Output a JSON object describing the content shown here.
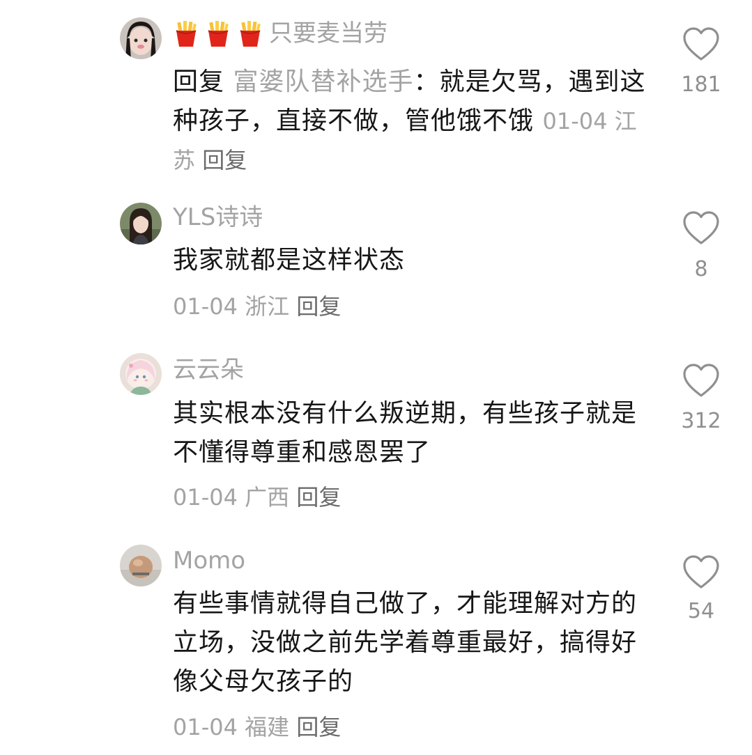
{
  "comments": [
    {
      "username": "只要麦当劳",
      "username_prefix_icons": [
        "fries-emoji",
        "fries-emoji",
        "fries-emoji"
      ],
      "reply_prefix": "回复",
      "reply_to": "富婆队替补选手",
      "separator": "：",
      "text": "就是欠骂，遇到这种孩子，直接不做，管他饿不饿",
      "date": "01-04",
      "location": "江苏",
      "reply_label": "回复",
      "likes": "181"
    },
    {
      "username": "YLS诗诗",
      "text": "我家就都是这样状态",
      "date": "01-04",
      "location": "浙江",
      "reply_label": "回复",
      "likes": "8"
    },
    {
      "username": "云云朵",
      "text": "其实根本没有什么叛逆期，有些孩子就是不懂得尊重和感恩罢了",
      "date": "01-04",
      "location": "广西",
      "reply_label": "回复",
      "likes": "312"
    },
    {
      "username": "Momo",
      "text": "有些事情就得自己做了，才能理解对方的立场，没做之前先学着尊重最好，搞得好像父母欠孩子的",
      "date": "01-04",
      "location": "福建",
      "reply_label": "回复",
      "likes": "54"
    }
  ],
  "colors": {
    "username": "#a3a3a3",
    "text": "#161616",
    "meta": "#a3a3a3",
    "like_outline": "#8f8f8f"
  },
  "icons": {
    "like": "heart-outline-icon"
  }
}
